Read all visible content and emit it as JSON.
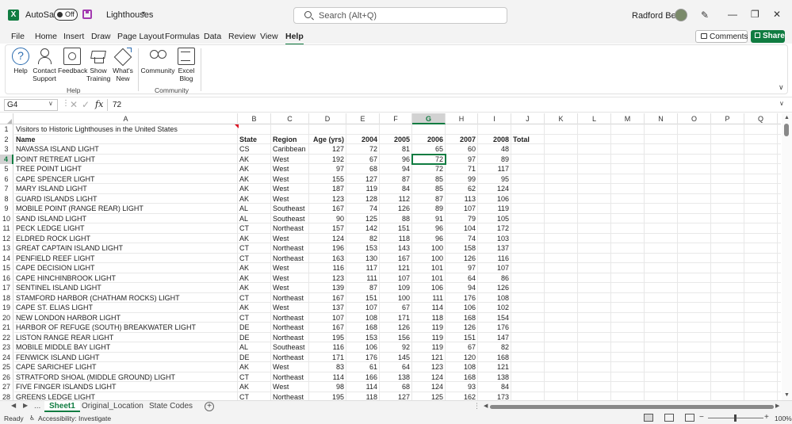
{
  "app": {
    "autosave_label": "AutoSave",
    "autosave_state": "Off",
    "document_title": "Lighthouses",
    "search_placeholder": "Search (Alt+Q)",
    "user_name": "Radford Bean"
  },
  "menu": [
    "File",
    "Home",
    "Insert",
    "Draw",
    "Page Layout",
    "Formulas",
    "Data",
    "Review",
    "View",
    "Help"
  ],
  "menu_active": "Help",
  "actions": {
    "comments": "Comments",
    "share": "Share"
  },
  "ribbon": {
    "help_group": {
      "label": "Help",
      "buttons": [
        {
          "label": "Help",
          "icon": "help-icon"
        },
        {
          "label": "Contact Support",
          "icon": "contact-support-icon"
        },
        {
          "label": "Feedback",
          "icon": "feedback-icon"
        },
        {
          "label": "Show Training",
          "icon": "training-icon"
        },
        {
          "label": "What's New",
          "icon": "whats-new-icon"
        }
      ]
    },
    "community_group": {
      "label": "Community",
      "buttons": [
        {
          "label": "Community",
          "icon": "community-icon"
        },
        {
          "label": "Excel Blog",
          "icon": "excel-blog-icon"
        }
      ]
    }
  },
  "formula_bar": {
    "name_box": "G4",
    "value": "72"
  },
  "columns": [
    "A",
    "B",
    "C",
    "D",
    "E",
    "F",
    "G",
    "H",
    "I",
    "J",
    "K",
    "L",
    "M",
    "N",
    "O",
    "P",
    "Q",
    "R",
    "S"
  ],
  "selected_column": "G",
  "selected_row": 4,
  "title_row": "Visitors to Historic Lighthouses in the United States",
  "headers": [
    "Name",
    "State",
    "Region",
    "Age (yrs)",
    "2004",
    "2005",
    "2006",
    "2007",
    "2008",
    "Total"
  ],
  "rows": [
    [
      "NAVASSA ISLAND LIGHT",
      "CS",
      "Caribbean",
      "127",
      "72",
      "81",
      "65",
      "60",
      "48"
    ],
    [
      "POINT RETREAT LIGHT",
      "AK",
      "West",
      "192",
      "67",
      "96",
      "72",
      "97",
      "89"
    ],
    [
      "TREE POINT LIGHT",
      "AK",
      "West",
      "97",
      "68",
      "94",
      "72",
      "71",
      "117"
    ],
    [
      "CAPE SPENCER LIGHT",
      "AK",
      "West",
      "155",
      "127",
      "87",
      "85",
      "99",
      "95"
    ],
    [
      "MARY ISLAND LIGHT",
      "AK",
      "West",
      "187",
      "119",
      "84",
      "85",
      "62",
      "124"
    ],
    [
      "GUARD ISLANDS LIGHT",
      "AK",
      "West",
      "123",
      "128",
      "112",
      "87",
      "113",
      "106"
    ],
    [
      "MOBILE POINT (RANGE REAR) LIGHT",
      "AL",
      "Southeast",
      "167",
      "74",
      "126",
      "89",
      "107",
      "119"
    ],
    [
      "SAND ISLAND LIGHT",
      "AL",
      "Southeast",
      "90",
      "125",
      "88",
      "91",
      "79",
      "105"
    ],
    [
      "PECK LEDGE LIGHT",
      "CT",
      "Northeast",
      "157",
      "142",
      "151",
      "96",
      "104",
      "172"
    ],
    [
      "ELDRED ROCK LIGHT",
      "AK",
      "West",
      "124",
      "82",
      "118",
      "96",
      "74",
      "103"
    ],
    [
      "GREAT CAPTAIN ISLAND LIGHT",
      "CT",
      "Northeast",
      "196",
      "153",
      "143",
      "100",
      "158",
      "137"
    ],
    [
      "PENFIELD REEF LIGHT",
      "CT",
      "Northeast",
      "163",
      "130",
      "167",
      "100",
      "126",
      "116"
    ],
    [
      "CAPE DECISION LIGHT",
      "AK",
      "West",
      "116",
      "117",
      "121",
      "101",
      "97",
      "107"
    ],
    [
      "CAPE HINCHINBROOK LIGHT",
      "AK",
      "West",
      "123",
      "111",
      "107",
      "101",
      "64",
      "86"
    ],
    [
      "SENTINEL ISLAND LIGHT",
      "AK",
      "West",
      "139",
      "87",
      "109",
      "106",
      "94",
      "126"
    ],
    [
      "STAMFORD HARBOR (CHATHAM ROCKS) LIGHT",
      "CT",
      "Northeast",
      "167",
      "151",
      "100",
      "111",
      "176",
      "108"
    ],
    [
      "CAPE ST. ELIAS LIGHT",
      "AK",
      "West",
      "137",
      "107",
      "67",
      "114",
      "106",
      "102"
    ],
    [
      "NEW LONDON HARBOR LIGHT",
      "CT",
      "Northeast",
      "107",
      "108",
      "171",
      "118",
      "168",
      "154"
    ],
    [
      "HARBOR OF REFUGE (SOUTH) BREAKWATER LIGHT",
      "DE",
      "Northeast",
      "167",
      "168",
      "126",
      "119",
      "126",
      "176"
    ],
    [
      "LISTON RANGE REAR LIGHT",
      "DE",
      "Northeast",
      "195",
      "153",
      "156",
      "119",
      "151",
      "147"
    ],
    [
      "MOBILE MIDDLE BAY LIGHT",
      "AL",
      "Southeast",
      "116",
      "106",
      "92",
      "119",
      "67",
      "82"
    ],
    [
      "FENWICK ISLAND LIGHT",
      "DE",
      "Northeast",
      "171",
      "176",
      "145",
      "121",
      "120",
      "168"
    ],
    [
      "CAPE SARICHEF LIGHT",
      "AK",
      "West",
      "83",
      "61",
      "64",
      "123",
      "108",
      "121"
    ],
    [
      "STRATFORD SHOAL (MIDDLE GROUND) LIGHT",
      "CT",
      "Northeast",
      "114",
      "166",
      "138",
      "124",
      "168",
      "138"
    ],
    [
      "FIVE FINGER ISLANDS LIGHT",
      "AK",
      "West",
      "98",
      "114",
      "68",
      "124",
      "93",
      "84"
    ],
    [
      "GREENS LEDGE LIGHT",
      "CT",
      "Northeast",
      "195",
      "118",
      "127",
      "125",
      "162",
      "173"
    ]
  ],
  "sheets": [
    "Sheet1",
    "Original_Location",
    "State Codes"
  ],
  "active_sheet": "Sheet1",
  "sheet_nav_ellipsis": "...",
  "status": {
    "ready": "Ready",
    "accessibility": "Accessibility: Investigate",
    "zoom": "100%"
  }
}
